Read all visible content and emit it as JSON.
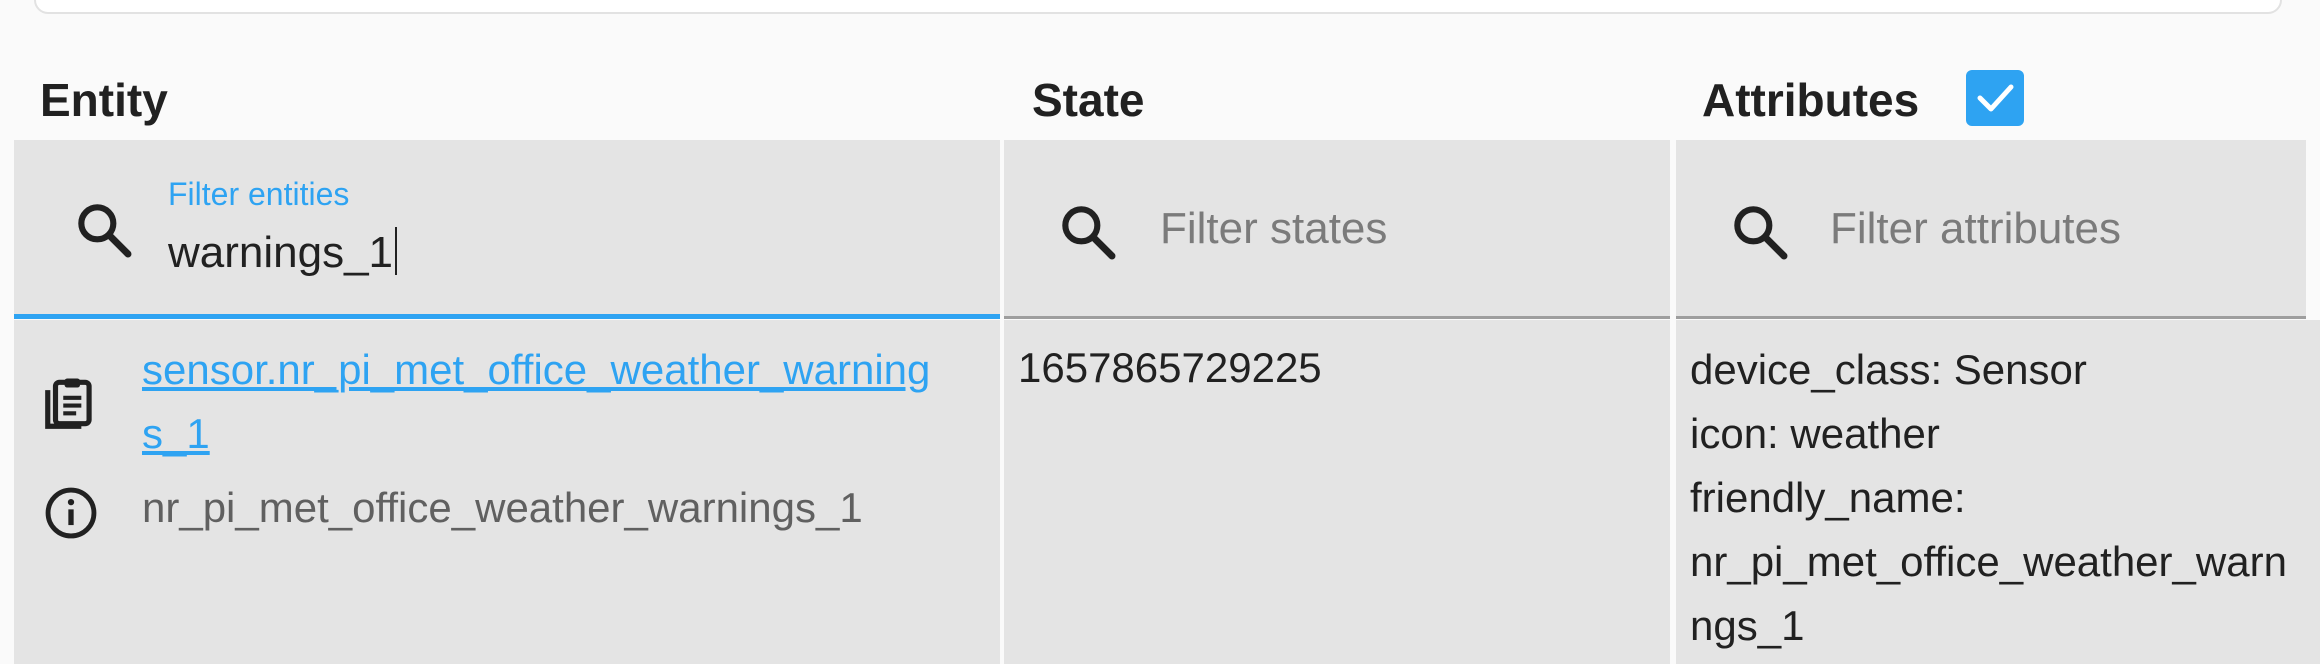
{
  "table": {
    "headers": {
      "entity": "Entity",
      "state": "State",
      "attributes": "Attributes"
    },
    "attributes_checkbox_checked": true,
    "filters": {
      "entity": {
        "label": "Filter entities",
        "value": "warnings_1"
      },
      "state": {
        "placeholder": "Filter states"
      },
      "attributes": {
        "placeholder": "Filter attributes"
      }
    },
    "rows": [
      {
        "entity_id": "sensor.nr_pi_met_office_weather_warnings_1",
        "entity_id_line1": "sensor.nr_pi_met_office_weather_warning",
        "entity_id_line2": "s_1",
        "name": "nr_pi_met_office_weather_warnings_1",
        "state": "1657865729225",
        "attributes_lines": [
          "device_class: Sensor",
          "icon: weather",
          "friendly_name:",
          "nr_pi_met_office_weather_warn",
          "ngs_1"
        ]
      }
    ]
  },
  "colors": {
    "accent": "#2ea3f2",
    "cell_bg": "#e4e4e4",
    "page_bg": "#fafafa"
  },
  "icons": [
    "search-icon",
    "clipboard-icon",
    "info-icon",
    "checkbox-checked-icon"
  ]
}
